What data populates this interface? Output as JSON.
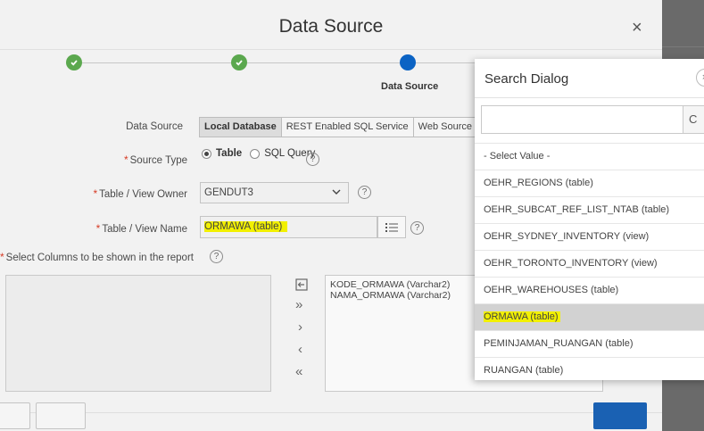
{
  "dialog": {
    "title": "Data Source",
    "close_glyph": "×"
  },
  "wizard": {
    "steps": [
      {
        "state": "complete"
      },
      {
        "state": "complete"
      },
      {
        "state": "current",
        "label": "Data Source"
      }
    ]
  },
  "form": {
    "data_source_label": "Data Source",
    "data_source_options": [
      "Local Database",
      "REST Enabled SQL Service",
      "Web Source"
    ],
    "data_source_selected": "Local Database",
    "source_type_label": "Source Type",
    "source_type_options": [
      "Table",
      "SQL Query"
    ],
    "source_type_selected": "Table",
    "owner_label": "Table / View Owner",
    "owner_value": "GENDUT3",
    "name_label": "Table / View Name",
    "name_value": "ORMAWA (table)",
    "columns_label": "Select Columns to be shown in the report",
    "selected_columns": [
      "KODE_ORMAWA (Varchar2)",
      "NAMA_ORMAWA (Varchar2)"
    ],
    "help_glyph": "?"
  },
  "shuttle_controls": [
    "reset",
    "move-all",
    "move",
    "remove",
    "remove-all"
  ],
  "search_dialog": {
    "title": "Search Dialog",
    "input_value": "",
    "go_glyph": "C",
    "close_glyph": "×",
    "results": [
      "- Select Value -",
      "OEHR_REGIONS (table)",
      "OEHR_SUBCAT_REF_LIST_NTAB (table)",
      "OEHR_SYDNEY_INVENTORY (view)",
      "OEHR_TORONTO_INVENTORY (view)",
      "OEHR_WAREHOUSES (table)",
      "ORMAWA (table)",
      "PEMINJAMAN_RUANGAN (table)",
      "RUANGAN (table)"
    ],
    "selected_result": "ORMAWA (table)"
  },
  "colors": {
    "accent": "#0b63c4",
    "complete": "#5ba84e",
    "required": "#d63b25",
    "highlight": "#f2f000",
    "primary_button": "#1a61b3"
  }
}
